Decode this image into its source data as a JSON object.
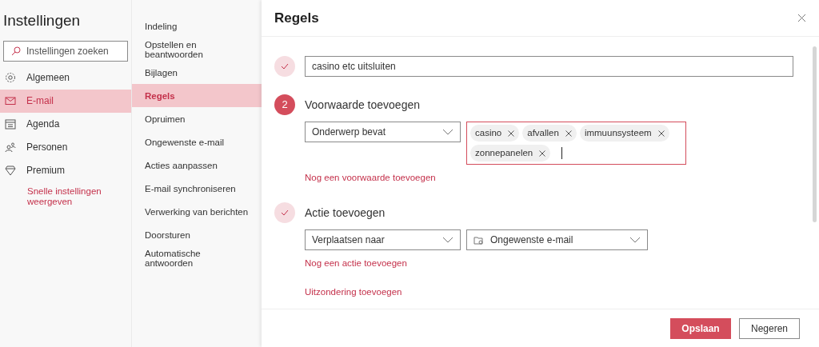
{
  "sidebar": {
    "title": "Instellingen",
    "search": {
      "placeholder": "Instellingen zoeken"
    },
    "items": [
      {
        "label": "Algemeen",
        "kind": "gear",
        "selected": false
      },
      {
        "label": "E-mail",
        "kind": "mail",
        "selected": true
      },
      {
        "label": "Agenda",
        "kind": "calendar",
        "selected": false
      },
      {
        "label": "Personen",
        "kind": "people",
        "selected": false
      },
      {
        "label": "Premium",
        "kind": "diamond",
        "selected": false
      }
    ],
    "link": "Snelle instellingen weergeven"
  },
  "subnav": {
    "items": [
      {
        "label": "Indeling",
        "selected": false
      },
      {
        "label": "Opstellen en beantwoorden",
        "selected": false
      },
      {
        "label": "Bijlagen",
        "selected": false
      },
      {
        "label": "Regels",
        "selected": true
      },
      {
        "label": "Opruimen",
        "selected": false
      },
      {
        "label": "Ongewenste e-mail",
        "selected": false
      },
      {
        "label": "Acties aanpassen",
        "selected": false
      },
      {
        "label": "E-mail synchroniseren",
        "selected": false
      },
      {
        "label": "Verwerking van berichten",
        "selected": false
      },
      {
        "label": "Doorsturen",
        "selected": false
      },
      {
        "label": "Automatische antwoorden",
        "selected": false
      }
    ]
  },
  "panel": {
    "title": "Regels",
    "steps": [
      {
        "kind": "done",
        "name_value": "casino etc uitsluiten"
      },
      {
        "kind": "current",
        "number": "2",
        "title": "Voorwaarde toevoegen",
        "condition": "Onderwerp bevat",
        "tags": [
          "casino",
          "afvallen",
          "immuunsysteem",
          "zonnepanelen"
        ],
        "links": [
          "Nog een voorwaarde toevoegen"
        ]
      },
      {
        "kind": "done",
        "title": "Actie toevoegen",
        "action": "Verplaatsen naar",
        "folder": "Ongewenste e-mail",
        "links": [
          "Nog een actie toevoegen",
          "Uitzondering toevoegen"
        ]
      }
    ],
    "buttons": [
      {
        "label": "Opslaan",
        "kind": "primary"
      },
      {
        "label": "Negeren",
        "kind": "secondary"
      }
    ]
  }
}
